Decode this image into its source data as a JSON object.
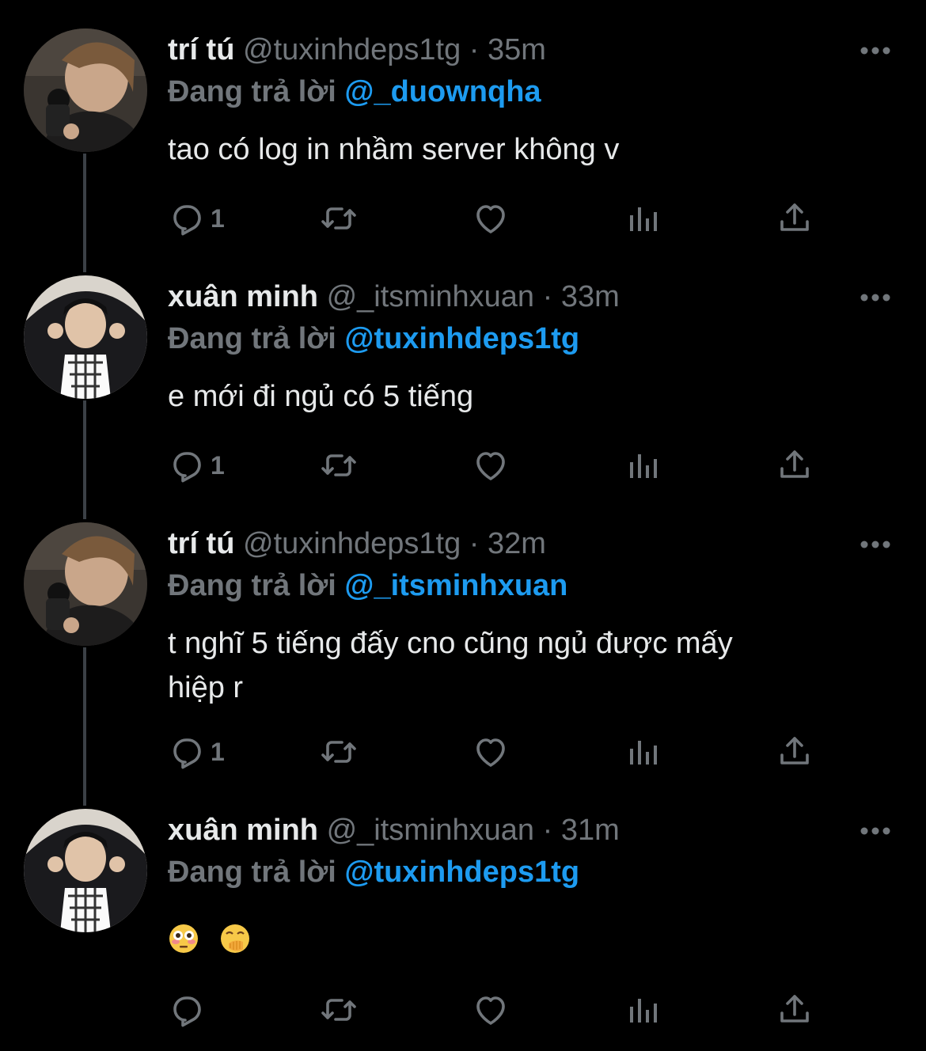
{
  "colors": {
    "background": "#000000",
    "primary_text": "#e7e9ea",
    "secondary_text": "#71767b",
    "mention": "#1d9bf0",
    "thread_line": "#3b4046"
  },
  "tweets": [
    {
      "name": "trí tú",
      "handle": "@tuxinhdeps1tg",
      "separator": "·",
      "time": "35m",
      "reply_label": "Đang trả lời",
      "reply_to": "@_duownqha",
      "text": "tao có log in nhầm server không v",
      "reply_count": "1",
      "avatar": "avatar-tri-tu"
    },
    {
      "name": "xuân minh",
      "handle": "@_itsminhxuan",
      "separator": "·",
      "time": "33m",
      "reply_label": "Đang trả lời",
      "reply_to": "@tuxinhdeps1tg",
      "text": "e mới đi ngủ có 5 tiếng",
      "reply_count": "1",
      "avatar": "avatar-xuan-minh"
    },
    {
      "name": "trí tú",
      "handle": "@tuxinhdeps1tg",
      "separator": "·",
      "time": "32m",
      "reply_label": "Đang trả lời",
      "reply_to": "@_itsminhxuan",
      "text_line1": "t nghĩ 5 tiếng đấy cno cũng ngủ được mấy",
      "text_line2": "hiệp r",
      "reply_count": "1",
      "avatar": "avatar-tri-tu"
    },
    {
      "name": "xuân minh",
      "handle": "@_itsminhxuan",
      "separator": "·",
      "time": "31m",
      "reply_label": "Đang trả lời",
      "reply_to": "@tuxinhdeps1tg",
      "emojis": [
        "flushed-face-emoji",
        "face-with-hand-over-mouth-emoji"
      ],
      "reply_count": "",
      "avatar": "avatar-xuan-minh"
    }
  ],
  "icons": {
    "reply": "reply-icon",
    "retweet": "retweet-icon",
    "like": "heart-icon",
    "views": "analytics-icon",
    "share": "share-icon",
    "more": "more-dots-icon"
  }
}
